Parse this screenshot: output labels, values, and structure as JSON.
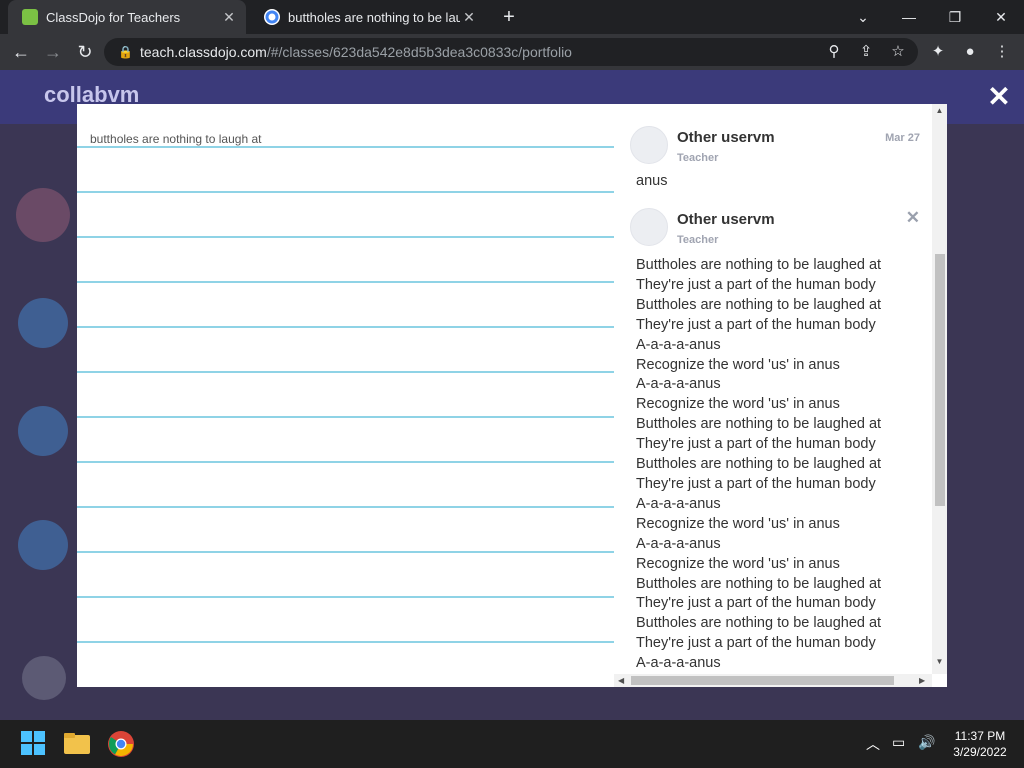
{
  "browser": {
    "tabs": [
      {
        "title": "ClassDojo for Teachers",
        "active": true
      },
      {
        "title": "buttholes are nothing to be laugh",
        "active": false
      }
    ],
    "new_tab_label": "+",
    "url_host": "teach.classdojo.com",
    "url_path": "/#/classes/623da542e8d5b3dea3c0833c/portfolio"
  },
  "background_page": {
    "class_name": "collabvm"
  },
  "modal": {
    "note_text": "buttholes are nothing to laugh at",
    "comments": [
      {
        "author": "Other uservm",
        "role": "Teacher",
        "date": "Mar 27",
        "body": "anus"
      },
      {
        "author": "Other uservm",
        "role": "Teacher",
        "body": "Buttholes are nothing to be laughed at\nThey're just a part of the human body\nButtholes are nothing to be laughed at\nThey're just a part of the human body\nA-a-a-a-anus\nRecognize the word 'us' in anus\nA-a-a-a-anus\nRecognize the word 'us' in anus\nButtholes are nothing to be laughed at\nThey're just a part of the human body\nButtholes are nothing to be laughed at\nThey're just a part of the human body\nA-a-a-a-anus\nRecognize the word 'us' in anus\nA-a-a-a-anus\nRecognize the word 'us' in anus\nButtholes are nothing to be laughed at\nThey're just a part of the human body\nButtholes are nothing to be laughed at\nThey're just a part of the human body\nA-a-a-a-anus"
      }
    ]
  },
  "taskbar": {
    "time": "11:37 PM",
    "date": "3/29/2022"
  },
  "colors": {
    "accent_line": "#8fd3e6",
    "overlay_bg": "#3b3654",
    "chrome_bg": "#202124"
  }
}
